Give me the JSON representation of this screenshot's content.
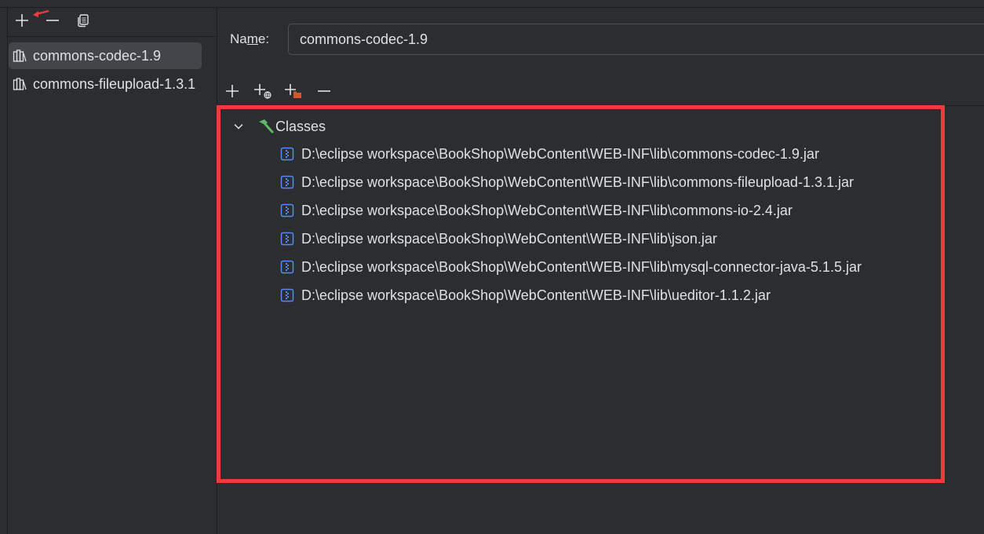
{
  "left_panel": {
    "libraries": [
      {
        "label": "commons-codec-1.9",
        "selected": true
      },
      {
        "label": "commons-fileupload-1.3.1",
        "selected": false
      }
    ],
    "toolbar_icons": [
      "plus-icon",
      "minus-icon",
      "copy-icon"
    ]
  },
  "right_panel": {
    "name_label_prefix": "Na",
    "name_label_mnemonic": "m",
    "name_label_suffix": "e:",
    "name_value": "commons-codec-1.9",
    "toolbar_icons": [
      "plus-icon",
      "add-url-icon",
      "add-folder-icon",
      "minus-icon"
    ],
    "tree": {
      "root_label": "Classes",
      "entries": [
        "D:\\eclipse workspace\\BookShop\\WebContent\\WEB-INF\\lib\\commons-codec-1.9.jar",
        "D:\\eclipse workspace\\BookShop\\WebContent\\WEB-INF\\lib\\commons-fileupload-1.3.1.jar",
        "D:\\eclipse workspace\\BookShop\\WebContent\\WEB-INF\\lib\\commons-io-2.4.jar",
        "D:\\eclipse workspace\\BookShop\\WebContent\\WEB-INF\\lib\\json.jar",
        "D:\\eclipse workspace\\BookShop\\WebContent\\WEB-INF\\lib\\mysql-connector-java-5.1.5.jar",
        "D:\\eclipse workspace\\BookShop\\WebContent\\WEB-INF\\lib\\ueditor-1.1.2.jar"
      ]
    }
  },
  "colors": {
    "background": "#2b2d30",
    "selection": "#43454a",
    "highlight_border": "#ee3b3b",
    "jar_icon": "#548af7",
    "hammer_icon": "#5fb865"
  }
}
